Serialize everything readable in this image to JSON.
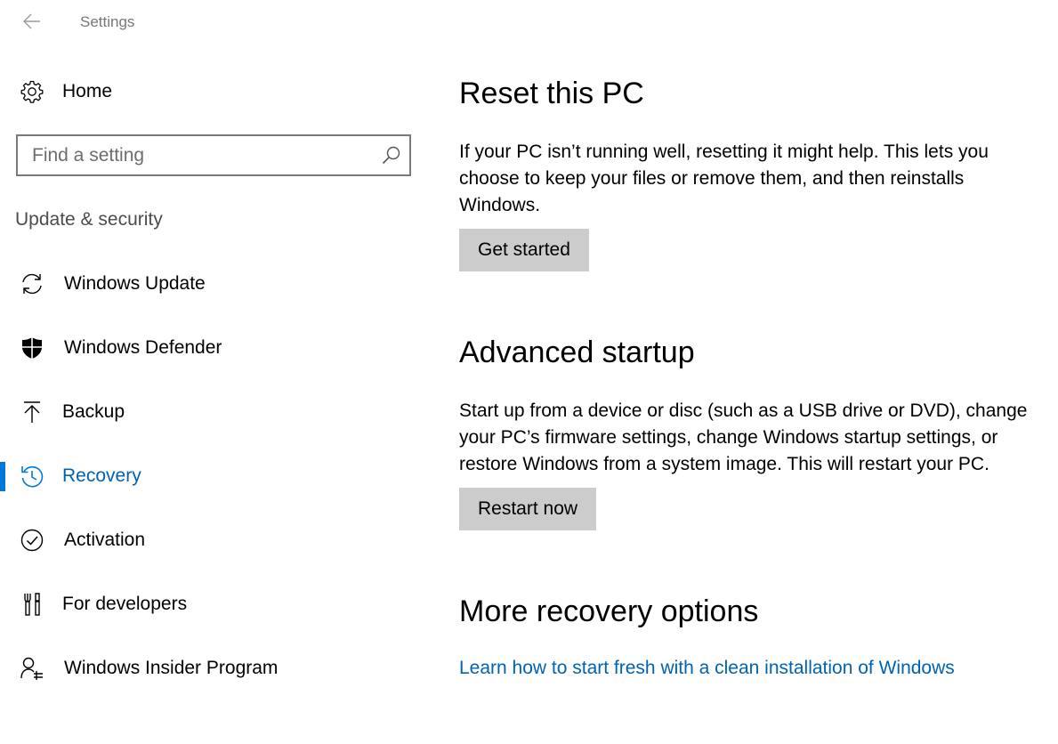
{
  "window": {
    "title": "Settings"
  },
  "sidebar": {
    "home_label": "Home",
    "search_placeholder": "Find a setting",
    "section_header": "Update & security",
    "items": [
      {
        "label": "Windows Update",
        "icon": "sync-icon"
      },
      {
        "label": "Windows Defender",
        "icon": "shield-icon"
      },
      {
        "label": "Backup",
        "icon": "upload-arrow-icon"
      },
      {
        "label": "Recovery",
        "icon": "history-icon",
        "selected": true
      },
      {
        "label": "Activation",
        "icon": "checkmark-circle-icon"
      },
      {
        "label": "For developers",
        "icon": "developer-tools-icon"
      },
      {
        "label": "Windows Insider Program",
        "icon": "insider-person-icon"
      }
    ]
  },
  "main": {
    "reset": {
      "heading": "Reset this PC",
      "description": "If your PC isn’t running well, resetting it might help. This lets you choose to keep your files or remove them, and then reinstalls Windows.",
      "button_label": "Get started"
    },
    "advanced": {
      "heading": "Advanced startup",
      "description": "Start up from a device or disc (such as a USB drive or DVD), change your PC’s firmware settings, change Windows startup settings, or restore Windows from a system image. This will restart your PC.",
      "button_label": "Restart now"
    },
    "more": {
      "heading": "More recovery options",
      "link_label": "Learn how to start fresh with a clean installation of Windows"
    }
  },
  "colors": {
    "accent": "#0078d7",
    "link": "#0063b1",
    "button_bg": "#cccccc",
    "secondary_text": "#767676"
  }
}
